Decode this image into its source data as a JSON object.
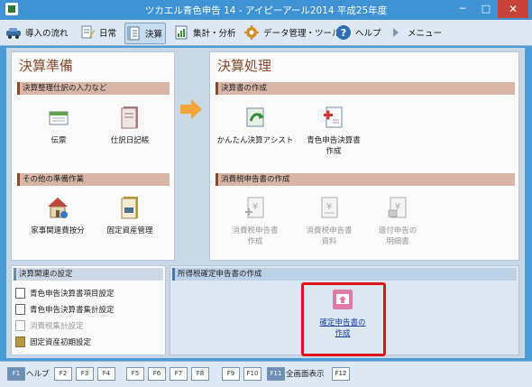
{
  "window": {
    "title": "ツカエル青色申告 14 - アイピーアール2014 平成25年度",
    "min": "─",
    "max": "□",
    "close": "✕"
  },
  "toolbar": [
    {
      "label": "導入の流れ",
      "icon": "car-icon"
    },
    {
      "label": "日常",
      "icon": "pencil-icon"
    },
    {
      "label": "決算",
      "icon": "ledger-icon"
    },
    {
      "label": "集計・分析",
      "icon": "report-icon"
    },
    {
      "label": "データ管理・ツール",
      "icon": "settings-icon"
    },
    {
      "label": "ヘルプ",
      "icon": "help-icon"
    },
    {
      "label": "メニュー",
      "icon": "menu-arrow-icon"
    }
  ],
  "prep": {
    "title": "決算準備",
    "entry_section": "決算整理仕訳の入力など",
    "denpyo": "伝票",
    "journal": "仕訳日記帳",
    "other_section": "その他の準備作業",
    "kaji": "家事関連費按分",
    "fixed_assets": "固定資産管理"
  },
  "proc": {
    "title": "決算処理",
    "statement_section": "決算書の作成",
    "assist": "かんたん決算アシスト",
    "aoiro_line1": "青色申告決算書",
    "aoiro_line2": "作成",
    "tax_section": "消費税申告書の作成",
    "tax_create_line1": "消費税申告書",
    "tax_create_line2": "作成",
    "tax_docs_line1": "消費税申告書",
    "tax_docs_line2": "資料",
    "refund_line1": "還付申告の",
    "refund_line2": "明細書"
  },
  "settings": {
    "title": "決算関連の設定",
    "links": [
      "青色申告決算書項目設定",
      "青色申告決算書集計設定",
      "消費税集計設定",
      "固定資産初期設定"
    ]
  },
  "income_tax": {
    "title": "所得税確定申告書の作成",
    "line1": "確定申告書の",
    "line2": "作成"
  },
  "fkeys": {
    "f1": "F1",
    "f1_label": "ヘルプ",
    "f2": "F2",
    "f3": "F3",
    "f4": "F4",
    "f5": "F5",
    "f6": "F6",
    "f7": "F7",
    "f8": "F8",
    "f9": "F9",
    "f10": "F10",
    "f11": "F11",
    "f11_label": "全画面表示",
    "f12": "F12"
  }
}
